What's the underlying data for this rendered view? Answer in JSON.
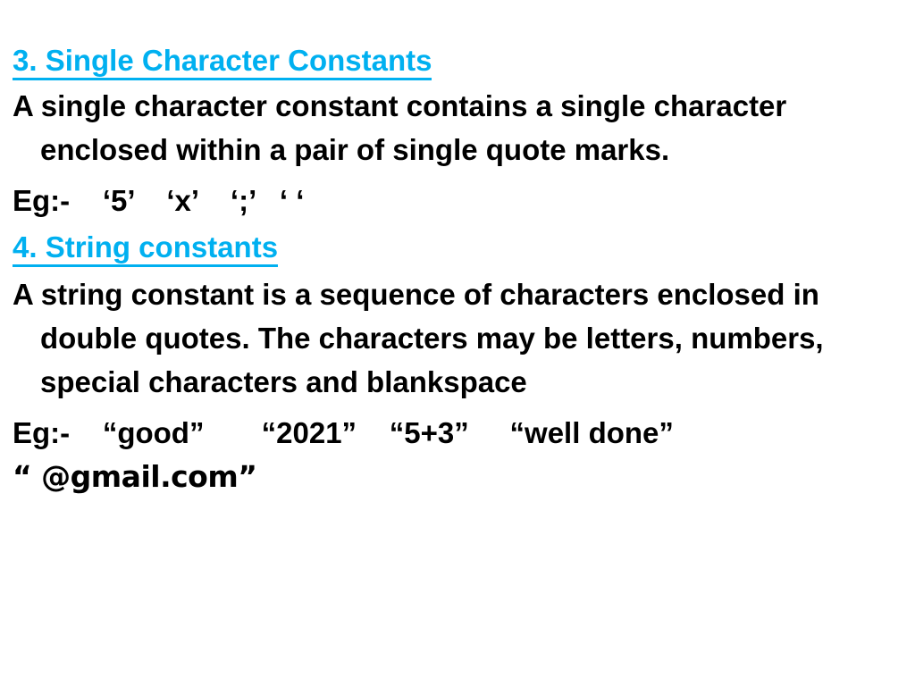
{
  "slide": {
    "background_color": "#FFFFFF",
    "heading_color": "#00B0F0",
    "body_color": "#000000",
    "sections": [
      {
        "heading": "3. Single Character Constants",
        "paragraph": "A single character constant contains a single character enclosed within a pair of single quote marks.",
        "example_label": "Eg:-",
        "example_text": "Eg:-    ‘5’    ‘x’    ‘;’   ‘ ‘",
        "examples": [
          "‘5’",
          "‘x’",
          "‘;’",
          "‘ ‘"
        ]
      },
      {
        "heading": "4. String constants",
        "paragraph": "A string constant is a sequence of characters enclosed in double quotes. The characters may be letters, numbers, special characters and blankspace",
        "example_label": "Eg:-",
        "example_text": "Eg:-    “good”       “2021”    “5+3”     “well done”",
        "example_text_2": "“ @gmail.com”",
        "examples": [
          "“good”",
          "“2021”",
          "“5+3”",
          "“well done”",
          "“ @gmail.com”"
        ]
      }
    ]
  }
}
